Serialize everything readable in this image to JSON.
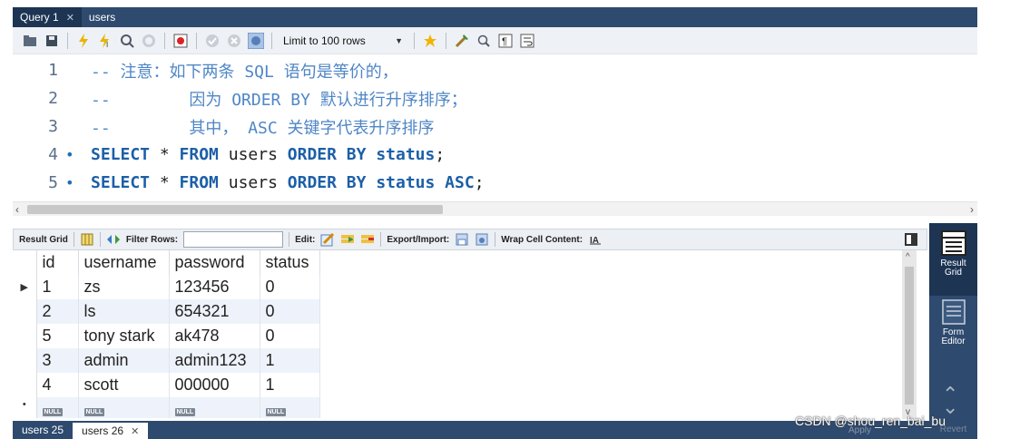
{
  "query_tabs": [
    {
      "label": "Query 1",
      "closable": true,
      "active": true
    },
    {
      "label": "users",
      "closable": false,
      "active": false
    }
  ],
  "toolbar": {
    "limit_label": "Limit to 100 rows",
    "icons": [
      "folder-open-icon",
      "save-icon",
      "execute-icon",
      "execute-current-icon",
      "explain-icon",
      "stop-icon",
      "toggle-stop-on-error-icon",
      "commit-icon",
      "rollback-icon",
      "autocommit-icon",
      "limit-dropdown",
      "beautify-icon",
      "find-icon",
      "invisible-chars-icon",
      "wrap-lines-icon"
    ]
  },
  "editor": {
    "lines": [
      {
        "num": "1",
        "dot": "",
        "segments": [
          {
            "t": "comment",
            "v": "-- 注意：如下两条 SQL 语句是等价的，"
          }
        ]
      },
      {
        "num": "2",
        "dot": "",
        "segments": [
          {
            "t": "comment",
            "v": "--        因为 ORDER BY 默认进行升序排序；"
          }
        ]
      },
      {
        "num": "3",
        "dot": "",
        "segments": [
          {
            "t": "comment",
            "v": "--        其中， ASC 关键字代表升序排序"
          }
        ]
      },
      {
        "num": "4",
        "dot": "•",
        "segments": [
          {
            "t": "kw",
            "v": "SELECT"
          },
          {
            "t": "plain",
            "v": " * "
          },
          {
            "t": "kw",
            "v": "FROM"
          },
          {
            "t": "plain",
            "v": " users "
          },
          {
            "t": "kw",
            "v": "ORDER BY"
          },
          {
            "t": "plain",
            "v": " "
          },
          {
            "t": "kw",
            "v": "status"
          },
          {
            "t": "plain",
            "v": ";"
          }
        ]
      },
      {
        "num": "5",
        "dot": "•",
        "segments": [
          {
            "t": "kw",
            "v": "SELECT"
          },
          {
            "t": "plain",
            "v": " * "
          },
          {
            "t": "kw",
            "v": "FROM"
          },
          {
            "t": "plain",
            "v": " users "
          },
          {
            "t": "kw",
            "v": "ORDER BY"
          },
          {
            "t": "plain",
            "v": " "
          },
          {
            "t": "kw",
            "v": "status ASC"
          },
          {
            "t": "plain",
            "v": ";"
          }
        ]
      }
    ]
  },
  "result_toolbar": {
    "result_grid_label": "Result Grid",
    "filter_label": "Filter Rows:",
    "edit_label": "Edit:",
    "export_label": "Export/Import:",
    "wrap_label": "Wrap Cell Content:"
  },
  "grid": {
    "columns": [
      "id",
      "username",
      "password",
      "status"
    ],
    "rows": [
      [
        "1",
        "zs",
        "123456",
        "0"
      ],
      [
        "2",
        "ls",
        "654321",
        "0"
      ],
      [
        "5",
        "tony stark",
        "ak478",
        "0"
      ],
      [
        "3",
        "admin",
        "admin123",
        "1"
      ],
      [
        "4",
        "scott",
        "000000",
        "1"
      ]
    ],
    "null_label": "NULL"
  },
  "side_panel": {
    "items": [
      {
        "label": "Result\nGrid",
        "icon": "result-grid-icon",
        "active": true
      },
      {
        "label": "Form\nEditor",
        "icon": "form-editor-icon",
        "active": false
      }
    ],
    "revert_label": "Revert"
  },
  "bottom_tabs": [
    {
      "label": "users 25",
      "closable": false,
      "active": false
    },
    {
      "label": "users 26",
      "closable": true,
      "active": true
    }
  ],
  "apply_label": "Apply",
  "watermark": "CSDN @shou_ren_bai_bu"
}
